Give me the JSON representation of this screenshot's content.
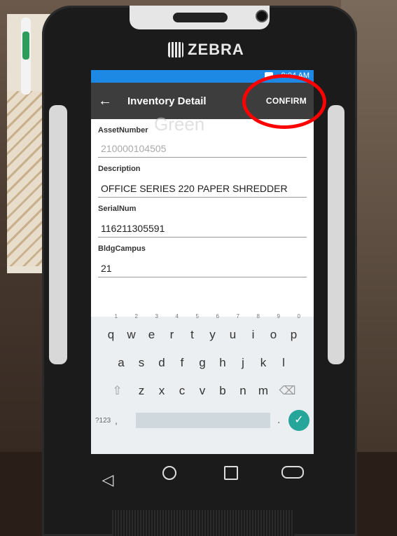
{
  "device": {
    "brand": "ZEBRA"
  },
  "status_bar": {
    "time": "9:04 AM"
  },
  "app_bar": {
    "title": "Inventory Detail",
    "confirm_label": "CONFIRM",
    "back_icon": "arrow-left-icon"
  },
  "form": {
    "background_text": "Green",
    "fields": [
      {
        "label": "AssetNumber",
        "value": "210000104505",
        "disabled": true
      },
      {
        "label": "Description",
        "value": "OFFICE SERIES 220 PAPER SHREDDER",
        "disabled": false
      },
      {
        "label": "SerialNum",
        "value": "116211305591",
        "disabled": false
      },
      {
        "label": "BldgCampus",
        "value": "21",
        "disabled": false
      }
    ]
  },
  "keyboard": {
    "row1": [
      "q",
      "w",
      "e",
      "r",
      "t",
      "y",
      "u",
      "i",
      "o",
      "p"
    ],
    "row1_numbers": [
      "1",
      "2",
      "3",
      "4",
      "5",
      "6",
      "7",
      "8",
      "9",
      "0"
    ],
    "row2": [
      "a",
      "s",
      "d",
      "f",
      "g",
      "h",
      "j",
      "k",
      "l"
    ],
    "row3": [
      "z",
      "x",
      "c",
      "v",
      "b",
      "n",
      "m"
    ],
    "symbols_label": "?123",
    "comma": ",",
    "period": ".",
    "shift_icon": "shift-icon",
    "delete_icon": "backspace-icon",
    "enter_icon": "checkmark-icon"
  },
  "nav_bar": {
    "back_icon": "triangle-back-icon",
    "home_icon": "circle-home-icon",
    "recent_icon": "square-recent-icon",
    "keyboard_icon": "keyboard-toggle-icon"
  },
  "annotation": {
    "color": "#ff0000",
    "target": "CONFIRM"
  }
}
